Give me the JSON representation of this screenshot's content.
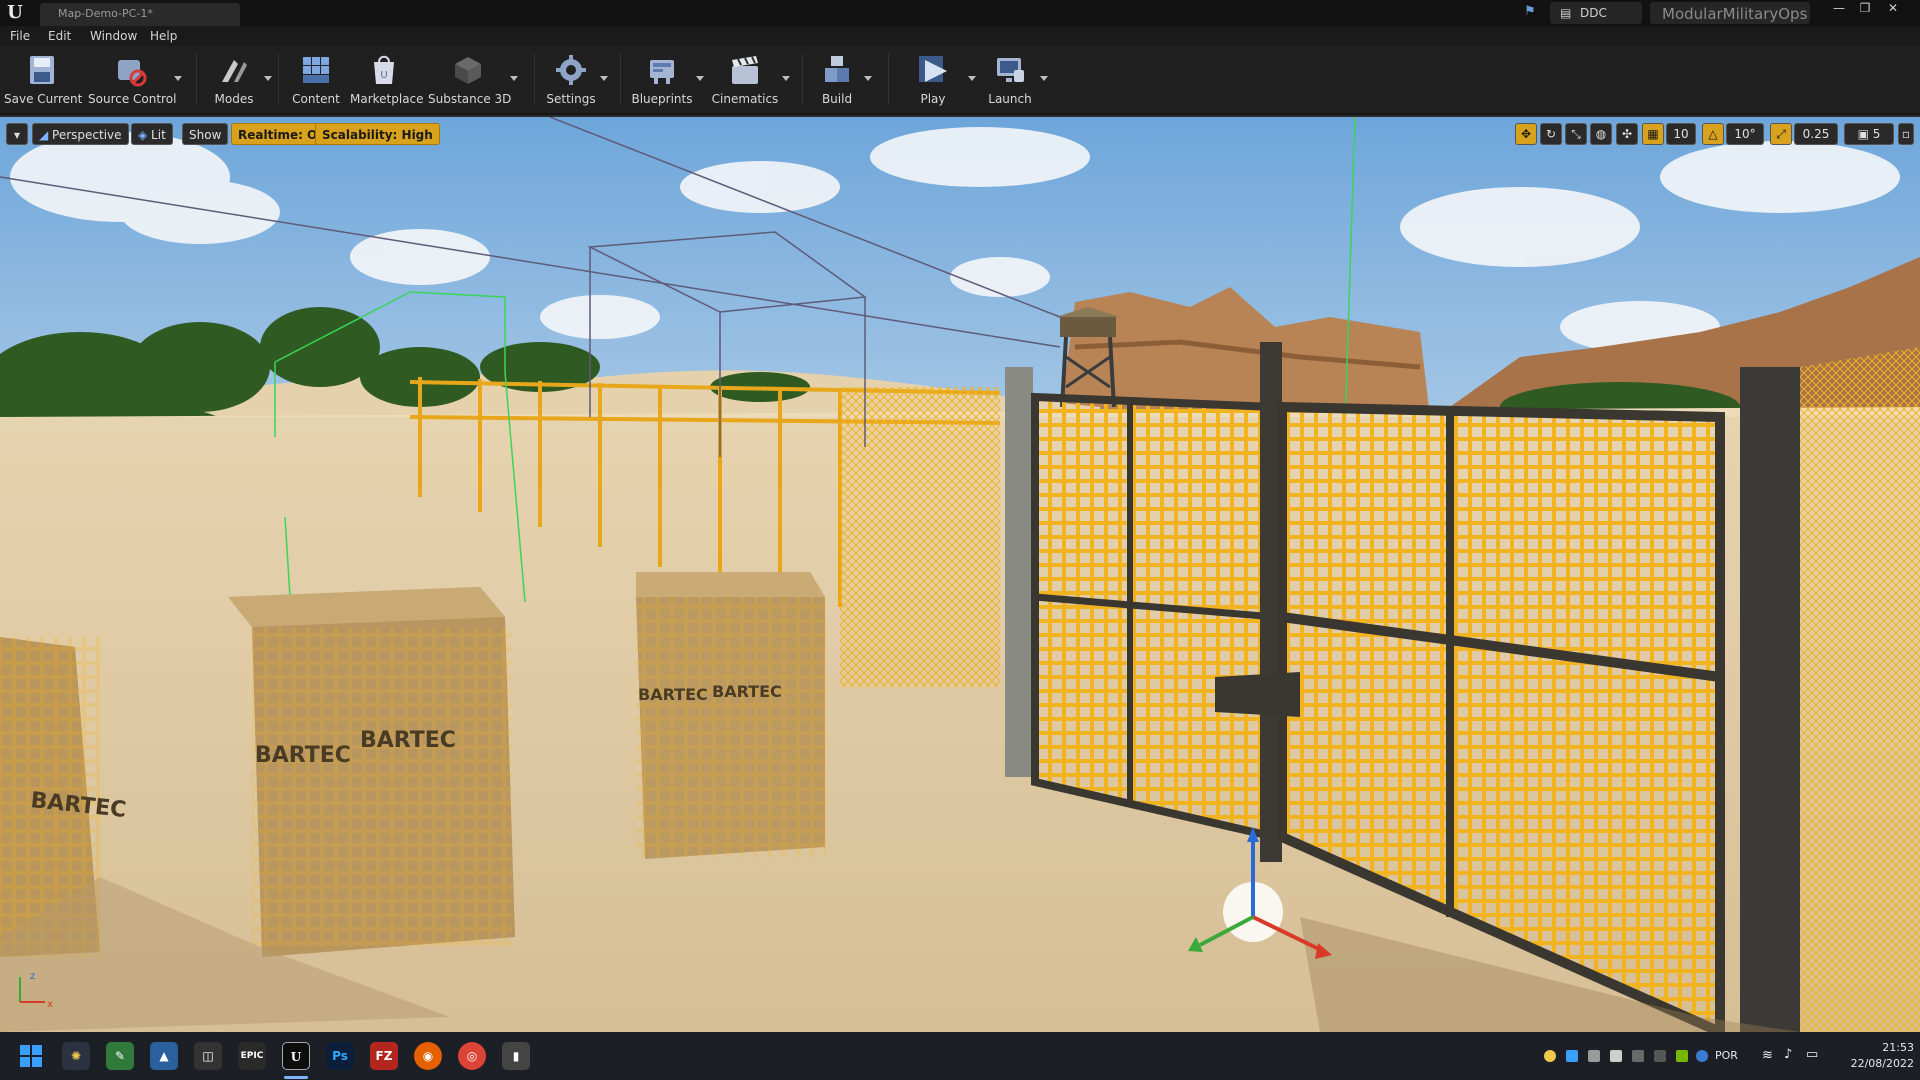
{
  "window": {
    "doc_tab": "Map-Demo-PC-1*",
    "ddc_label": "DDC",
    "project_name": "ModularMilitaryOps",
    "minimize": "—",
    "restore": "❐",
    "close": "✕"
  },
  "menu": [
    "File",
    "Edit",
    "Window",
    "Help"
  ],
  "toolbar": {
    "save_current": "Save Current",
    "source_control": "Source Control",
    "modes": "Modes",
    "content": "Content",
    "marketplace": "Marketplace",
    "substance_3d": "Substance 3D",
    "settings": "Settings",
    "blueprints": "Blueprints",
    "cinematics": "Cinematics",
    "build": "Build",
    "play": "Play",
    "launch": "Launch"
  },
  "viewport": {
    "perspective": "Perspective",
    "lit": "Lit",
    "show": "Show",
    "realtime": "Realtime: Off",
    "scalability": "Scalability: High",
    "grid_snap": "10",
    "rotation_snap": "10°",
    "scale_snap": "0.25",
    "camera_speed": "5",
    "crate_text": "BARTEC"
  },
  "taskbar": {
    "language": "POR",
    "time": "21:53",
    "date": "22/08/2022",
    "epic_label": "EPIC",
    "ps_label": "Ps",
    "fz_label": "FZ"
  },
  "colors": {
    "accent": "#d9a21c",
    "selection": "#ffb400",
    "sky": "#7fb2e0",
    "sand": "#e2cfa8"
  }
}
